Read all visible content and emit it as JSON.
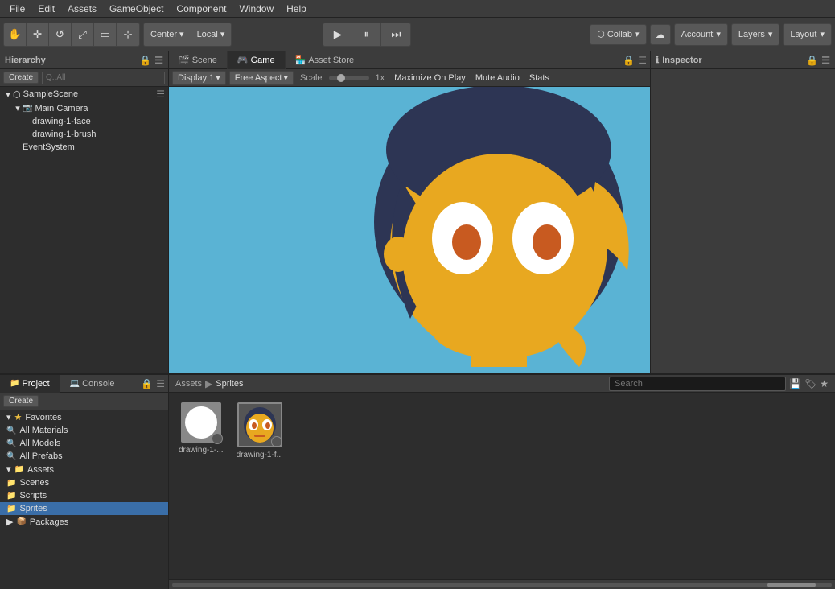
{
  "menu": {
    "items": [
      "File",
      "Edit",
      "Assets",
      "GameObject",
      "Component",
      "Window",
      "Help"
    ]
  },
  "toolbar": {
    "tools": [
      "hand",
      "move",
      "rotate",
      "scale",
      "rect",
      "transform"
    ],
    "pivot": "Center",
    "space": "Local",
    "play_tooltip": "Play",
    "pause_tooltip": "Pause",
    "step_tooltip": "Step",
    "collab": "Collab",
    "account": "Account",
    "layers": "Layers",
    "layout": "Layout"
  },
  "hierarchy": {
    "title": "Hierarchy",
    "create_label": "Create",
    "search_placeholder": "Q..All",
    "scene": "SampleScene",
    "items": [
      {
        "name": "Main Camera",
        "indent": 2,
        "type": "camera"
      },
      {
        "name": "drawing-1-face",
        "indent": 3,
        "type": "object"
      },
      {
        "name": "drawing-1-brush",
        "indent": 3,
        "type": "object"
      },
      {
        "name": "EventSystem",
        "indent": 2,
        "type": "event"
      }
    ]
  },
  "tabs": {
    "center": [
      {
        "label": "Scene",
        "active": false
      },
      {
        "label": "Game",
        "active": true
      },
      {
        "label": "Asset Store",
        "active": false
      }
    ]
  },
  "game_view": {
    "display": "Display 1",
    "aspect": "Free Aspect",
    "scale_label": "Scale",
    "scale_value": "1x",
    "maximize": "Maximize On Play",
    "mute": "Mute Audio",
    "stats": "Stats"
  },
  "inspector": {
    "title": "Inspector"
  },
  "bottom": {
    "tabs_left": [
      {
        "label": "Project",
        "active": true
      },
      {
        "label": "Console",
        "active": false
      }
    ],
    "create_label": "Create",
    "breadcrumb": [
      "Assets",
      "Sprites"
    ],
    "favorites": {
      "label": "Favorites",
      "items": [
        "All Materials",
        "All Models",
        "All Prefabs"
      ]
    },
    "assets_tree": {
      "label": "Assets",
      "children": [
        "Scenes",
        "Scripts",
        "Sprites"
      ]
    },
    "packages_label": "Packages",
    "assets": [
      {
        "name": "drawing-1-...",
        "type": "brush"
      },
      {
        "name": "drawing-1-f...",
        "type": "face"
      }
    ]
  }
}
